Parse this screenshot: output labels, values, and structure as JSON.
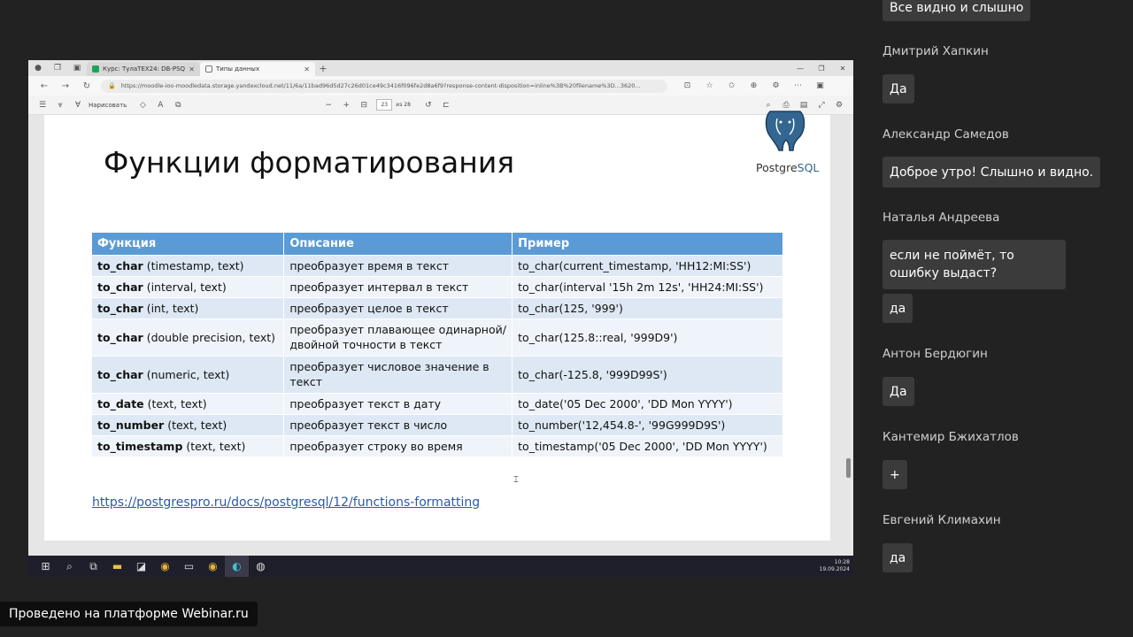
{
  "browser": {
    "tabs": [
      {
        "title": "Курс: ТулаТЕХ24: DB-PSQL-01: С",
        "fav_color": "#1ea35a"
      },
      {
        "title": "Типы данных",
        "fav_color": "#777777"
      }
    ],
    "url": "https://moodle-ioo-moodledata.storage.yandexcloud.net/11/6a/11bad96d5d27c26d01ce49c3416f096fe2d8a6f9?response-content-disposition=inline%3B%20filename%3D...3620...",
    "pdf_toolbar": {
      "draw_label": "Нарисовать",
      "page_current": "23",
      "page_total": "из 28"
    }
  },
  "slide": {
    "title": "Функции форматирования",
    "logo_text_1": "Postgre",
    "logo_text_2": "SQL",
    "table": {
      "headers": [
        "Функция",
        "Описание",
        "Пример"
      ],
      "rows": [
        {
          "fn": "to_char",
          "args": " (timestamp, text)",
          "desc": "преобразует время в текст",
          "example": "to_char(current_timestamp, 'HH12:MI:SS')"
        },
        {
          "fn": "to_char",
          "args": " (interval, text)",
          "desc": "преобразует интервал в текст",
          "example": "to_char(interval '15h 2m 12s', 'HH24:MI:SS')"
        },
        {
          "fn": "to_char",
          "args": " (int, text)",
          "desc": "преобразует целое в текст",
          "example": "to_char(125, '999')"
        },
        {
          "fn": "to_char",
          "args": " (double precision, text)",
          "desc": "преобразует плавающее одинарной/двойной точности в текст",
          "example": "to_char(125.8::real, '999D9')"
        },
        {
          "fn": "to_char",
          "args": " (numeric, text)",
          "desc": "преобразует числовое значение в текст",
          "example": "to_char(-125.8, '999D99S')"
        },
        {
          "fn": "to_date",
          "args": " (text, text)",
          "desc": "преобразует текст в дату",
          "example": "to_date('05 Dec 2000', 'DD Mon YYYY')"
        },
        {
          "fn": "to_number",
          "args": " (text, text)",
          "desc": "преобразует текст в число",
          "example": "to_number('12,454.8-', '99G999D9S')"
        },
        {
          "fn": "to_timestamp",
          "args": " (text, text)",
          "desc": "преобразует строку во время",
          "example": "to_timestamp('05 Dec 2000', 'DD Mon YYYY')"
        }
      ]
    },
    "link": "https://postgrespro.ru/docs/postgresql/12/functions-formatting"
  },
  "taskbar": {
    "time": "10:28",
    "date": "19.09.2024"
  },
  "chat": {
    "messages": [
      {
        "sender": "",
        "text": "Все видно и слышно"
      },
      {
        "sender": "Дмитрий Хапкин",
        "text": "Да"
      },
      {
        "sender": "Александр Самедов",
        "text": "Доброе утро! Слышно и видно."
      },
      {
        "sender": "Наталья Андреева",
        "text": "если не поймёт, то ошибку выдаст?"
      },
      {
        "sender": "",
        "text": "да"
      },
      {
        "sender": "Антон Бердюгин",
        "text": "Да"
      },
      {
        "sender": "Кантемир Бжихатлов",
        "text": "+"
      },
      {
        "sender": "Евгений Климахин",
        "text": "да"
      }
    ]
  },
  "platform_label": "Проведено на платформе Webinar.ru"
}
